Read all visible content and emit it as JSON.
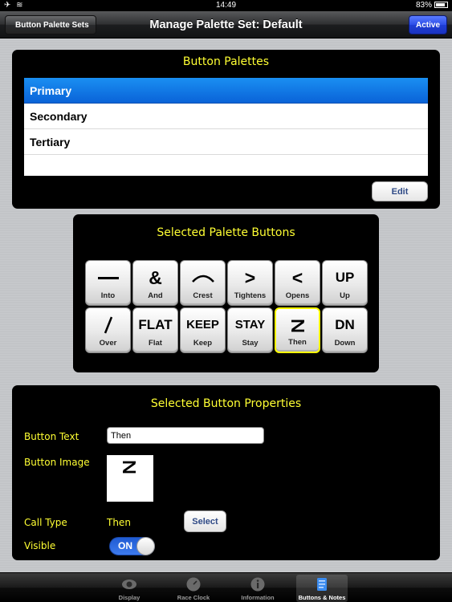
{
  "status_bar": {
    "time": "14:49",
    "battery": "83%"
  },
  "nav": {
    "back_label": "Button Palette Sets",
    "title": "Manage Palette Set: Default",
    "right_label": "Active"
  },
  "palettes_panel": {
    "title": "Button Palettes",
    "items": [
      {
        "label": "Primary",
        "selected": true
      },
      {
        "label": "Secondary",
        "selected": false
      },
      {
        "label": "Tertiary",
        "selected": false
      }
    ],
    "edit_label": "Edit"
  },
  "buttons_panel": {
    "title": "Selected Palette Buttons",
    "buttons": [
      {
        "glyph": "",
        "label": "Into"
      },
      {
        "glyph": "&",
        "label": "And"
      },
      {
        "glyph": "",
        "label": "Crest"
      },
      {
        "glyph": ">",
        "label": "Tightens"
      },
      {
        "glyph": "<",
        "label": "Opens"
      },
      {
        "glyph": "UP",
        "label": "Up"
      },
      {
        "glyph": "",
        "label": "Over"
      },
      {
        "glyph": "FLAT",
        "label": "Flat"
      },
      {
        "glyph": "KEEP",
        "label": "Keep"
      },
      {
        "glyph": "STAY",
        "label": "Stay"
      },
      {
        "glyph": "",
        "label": "Then",
        "selected": true
      },
      {
        "glyph": "DN",
        "label": "Down"
      }
    ]
  },
  "properties_panel": {
    "title": "Selected Button Properties",
    "button_text_label": "Button Text",
    "button_text_value": "Then",
    "button_image_label": "Button Image",
    "call_type_label": "Call Type",
    "call_type_value": "Then",
    "select_label": "Select",
    "visible_label": "Visible",
    "visible_toggle": "ON"
  },
  "tab_bar": {
    "tabs": [
      {
        "label": "Display",
        "icon": "eye-icon"
      },
      {
        "label": "Race Clock",
        "icon": "clock-icon"
      },
      {
        "label": "Information",
        "icon": "info-icon"
      },
      {
        "label": "Buttons & Notes",
        "icon": "notes-icon",
        "active": true
      }
    ]
  },
  "colors": {
    "panel_title": "#ffff33",
    "selection_blue": "#0a63d8",
    "active_button": "#2c4de8",
    "highlight_border": "#ffff00"
  }
}
